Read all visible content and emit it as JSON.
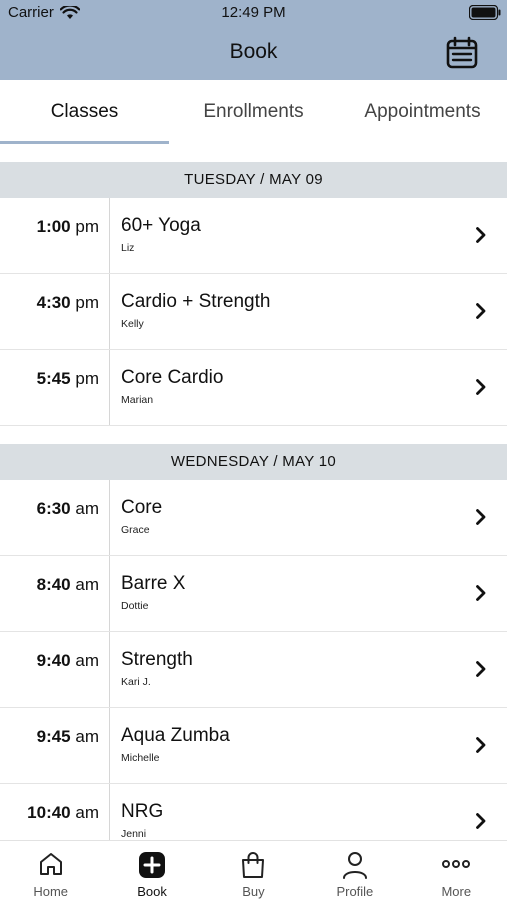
{
  "status": {
    "carrier": "Carrier",
    "time": "12:49 PM"
  },
  "nav": {
    "title": "Book",
    "calendar_icon": "calendar-icon"
  },
  "tabs": [
    {
      "label": "Classes",
      "active": true
    },
    {
      "label": "Enrollments",
      "active": false
    },
    {
      "label": "Appointments",
      "active": false
    }
  ],
  "days": [
    {
      "header": "TUESDAY / MAY 09",
      "classes": [
        {
          "time": "1:00",
          "ampm": "pm",
          "name": "60+ Yoga",
          "instructor": "Liz"
        },
        {
          "time": "4:30",
          "ampm": "pm",
          "name": "Cardio + Strength",
          "instructor": "Kelly"
        },
        {
          "time": "5:45",
          "ampm": "pm",
          "name": "Core Cardio",
          "instructor": "Marian"
        }
      ]
    },
    {
      "header": "WEDNESDAY / MAY 10",
      "classes": [
        {
          "time": "6:30",
          "ampm": "am",
          "name": "Core",
          "instructor": "Grace"
        },
        {
          "time": "8:40",
          "ampm": "am",
          "name": "Barre X",
          "instructor": "Dottie"
        },
        {
          "time": "9:40",
          "ampm": "am",
          "name": "Strength",
          "instructor": "Kari J."
        },
        {
          "time": "9:45",
          "ampm": "am",
          "name": "Aqua Zumba",
          "instructor": "Michelle"
        },
        {
          "time": "10:40",
          "ampm": "am",
          "name": "NRG",
          "instructor": "Jenni"
        }
      ]
    }
  ],
  "bottom_nav": [
    {
      "label": "Home",
      "icon": "home-icon",
      "active": false
    },
    {
      "label": "Book",
      "icon": "plus-square-icon",
      "active": true
    },
    {
      "label": "Buy",
      "icon": "shopping-bag-icon",
      "active": false
    },
    {
      "label": "Profile",
      "icon": "person-icon",
      "active": false
    },
    {
      "label": "More",
      "icon": "more-dots-icon",
      "active": false
    }
  ],
  "colors": {
    "header_bg": "#9fb3cb",
    "day_header_bg": "#d9dee2",
    "accent": "#9fb3cb"
  }
}
